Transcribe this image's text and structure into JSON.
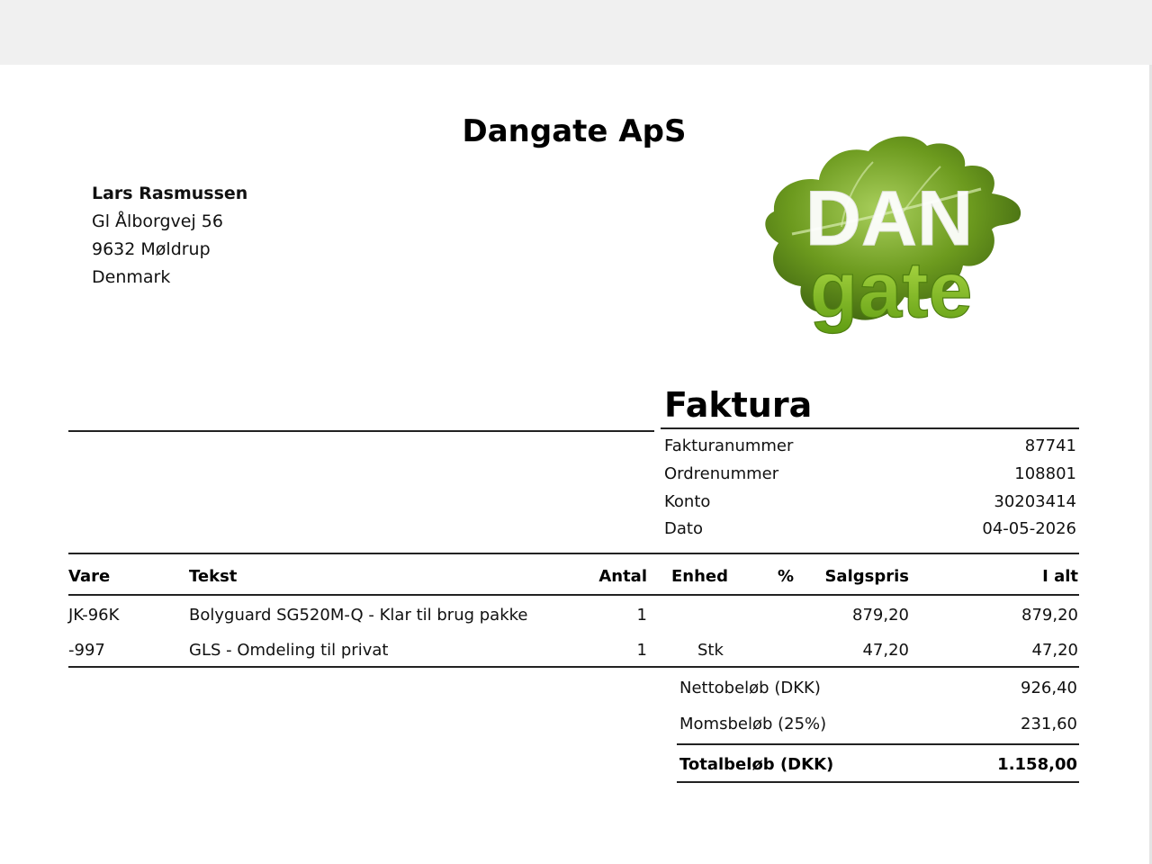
{
  "company": {
    "name": "Dangate ApS",
    "logo": {
      "top": "DAN",
      "bottom": "gate",
      "colors": {
        "leaf": "#6c9a1e",
        "leaf_dark": "#3e6410",
        "gate": "#7fbf1e",
        "dan": "#ffffff"
      }
    }
  },
  "customer": {
    "name": "Lars Rasmussen",
    "street": "Gl Ålborgvej 56",
    "city": "9632 Møldrup",
    "country": "Denmark"
  },
  "invoice": {
    "title": "Faktura",
    "fields": [
      {
        "label": "Fakturanummer",
        "value": "87741"
      },
      {
        "label": "Ordrenummer",
        "value": "108801"
      },
      {
        "label": "Konto",
        "value": "30203414"
      },
      {
        "label": "Dato",
        "value": "04-05-2026"
      }
    ]
  },
  "table": {
    "headers": {
      "vare": "Vare",
      "tekst": "Tekst",
      "antal": "Antal",
      "enhed": "Enhed",
      "pct": "%",
      "salgspris": "Salgspris",
      "ialt": "I alt"
    },
    "rows": [
      {
        "vare": "JK-96K",
        "tekst": "Bolyguard SG520M-Q - Klar til brug pakke",
        "antal": "1",
        "enhed": "",
        "pct": "",
        "salgspris": "879,20",
        "ialt": "879,20"
      },
      {
        "vare": "-997",
        "tekst": "GLS - Omdeling til privat",
        "antal": "1",
        "enhed": "Stk",
        "pct": "",
        "salgspris": "47,20",
        "ialt": "47,20"
      }
    ]
  },
  "totals": {
    "netto_label": "Nettobeløb (DKK)",
    "netto_value": "926,40",
    "moms_label": "Momsbeløb (25%)",
    "moms_value": "231,60",
    "total_label": "Totalbeløb (DKK)",
    "total_value": "1.158,00"
  }
}
